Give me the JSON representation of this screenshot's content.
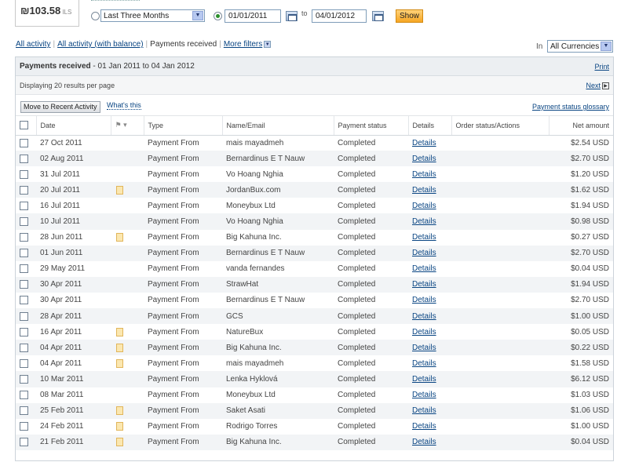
{
  "balance": {
    "amount": "₪103.58",
    "currency": "ILS"
  },
  "filter": {
    "period_label": "Last Three Months",
    "date_from": "01/01/2011",
    "to_label": "to",
    "date_to": "04/01/2012",
    "show_label": "Show"
  },
  "activity_tabs": {
    "all_activity": "All activity",
    "all_activity_balance": "All activity (with balance)",
    "payments_received": "Payments received",
    "more_filters": "More filters"
  },
  "currency_filter": {
    "in_label": "In",
    "value": "All Currencies"
  },
  "panel": {
    "title_bold": "Payments received",
    "title_range": " - 01 Jan 2011 to 04 Jan 2012",
    "print": "Print",
    "results_text": "Displaying 20 results per page",
    "next": "Next",
    "move_button": "Move to Recent Activity",
    "whats_this": "What's this",
    "glossary": "Payment status glossary"
  },
  "table": {
    "headers": {
      "date": "Date",
      "type": "Type",
      "name": "Name/Email",
      "status": "Payment status",
      "details": "Details",
      "order": "Order status/Actions",
      "amount": "Net amount"
    },
    "rows": [
      {
        "date": "27 Oct 2011",
        "note": false,
        "type": "Payment From",
        "name": "mais mayadmeh",
        "status": "Completed",
        "details": "Details",
        "amount": "$2.54 USD"
      },
      {
        "date": "02 Aug 2011",
        "note": false,
        "type": "Payment From",
        "name": "Bernardinus E T Nauw",
        "status": "Completed",
        "details": "Details",
        "amount": "$2.70 USD"
      },
      {
        "date": "31 Jul 2011",
        "note": false,
        "type": "Payment From",
        "name": "Vo Hoang Nghia",
        "status": "Completed",
        "details": "Details",
        "amount": "$1.20 USD"
      },
      {
        "date": "20 Jul 2011",
        "note": true,
        "type": "Payment From",
        "name": "JordanBux.com",
        "status": "Completed",
        "details": "Details",
        "amount": "$1.62 USD"
      },
      {
        "date": "16 Jul 2011",
        "note": false,
        "type": "Payment From",
        "name": "Moneybux Ltd",
        "status": "Completed",
        "details": "Details",
        "amount": "$1.94 USD"
      },
      {
        "date": "10 Jul 2011",
        "note": false,
        "type": "Payment From",
        "name": "Vo Hoang Nghia",
        "status": "Completed",
        "details": "Details",
        "amount": "$0.98 USD"
      },
      {
        "date": "28 Jun 2011",
        "note": true,
        "type": "Payment From",
        "name": "Big Kahuna Inc.",
        "status": "Completed",
        "details": "Details",
        "amount": "$0.27 USD"
      },
      {
        "date": "01 Jun 2011",
        "note": false,
        "type": "Payment From",
        "name": "Bernardinus E T Nauw",
        "status": "Completed",
        "details": "Details",
        "amount": "$2.70 USD"
      },
      {
        "date": "29 May 2011",
        "note": false,
        "type": "Payment From",
        "name": "vanda fernandes",
        "status": "Completed",
        "details": "Details",
        "amount": "$0.04 USD"
      },
      {
        "date": "30 Apr 2011",
        "note": false,
        "type": "Payment From",
        "name": "StrawHat",
        "status": "Completed",
        "details": "Details",
        "amount": "$1.94 USD"
      },
      {
        "date": "30 Apr 2011",
        "note": false,
        "type": "Payment From",
        "name": "Bernardinus E T Nauw",
        "status": "Completed",
        "details": "Details",
        "amount": "$2.70 USD"
      },
      {
        "date": "28 Apr 2011",
        "note": false,
        "type": "Payment From",
        "name": "GCS",
        "status": "Completed",
        "details": "Details",
        "amount": "$1.00 USD"
      },
      {
        "date": "16 Apr 2011",
        "note": true,
        "type": "Payment From",
        "name": "NatureBux",
        "status": "Completed",
        "details": "Details",
        "amount": "$0.05 USD"
      },
      {
        "date": "04 Apr 2011",
        "note": true,
        "type": "Payment From",
        "name": "Big Kahuna Inc.",
        "status": "Completed",
        "details": "Details",
        "amount": "$0.22 USD"
      },
      {
        "date": "04 Apr 2011",
        "note": true,
        "type": "Payment From",
        "name": "mais mayadmeh",
        "status": "Completed",
        "details": "Details",
        "amount": "$1.58 USD"
      },
      {
        "date": "10 Mar 2011",
        "note": false,
        "type": "Payment From",
        "name": "Lenka Hyklová",
        "status": "Completed",
        "details": "Details",
        "amount": "$6.12 USD"
      },
      {
        "date": "08 Mar 2011",
        "note": false,
        "type": "Payment From",
        "name": "Moneybux Ltd",
        "status": "Completed",
        "details": "Details",
        "amount": "$1.03 USD"
      },
      {
        "date": "25 Feb 2011",
        "note": true,
        "type": "Payment From",
        "name": "Saket Asati",
        "status": "Completed",
        "details": "Details",
        "amount": "$1.06 USD"
      },
      {
        "date": "24 Feb 2011",
        "note": true,
        "type": "Payment From",
        "name": "Rodrigo Torres",
        "status": "Completed",
        "details": "Details",
        "amount": "$1.00 USD"
      },
      {
        "date": "21 Feb 2011",
        "note": true,
        "type": "Payment From",
        "name": "Big Kahuna Inc.",
        "status": "Completed",
        "details": "Details",
        "amount": "$0.04 USD"
      }
    ]
  },
  "icons": {
    "flag": "flag-icon",
    "note": "note-icon",
    "calendar": "calendar-icon"
  }
}
